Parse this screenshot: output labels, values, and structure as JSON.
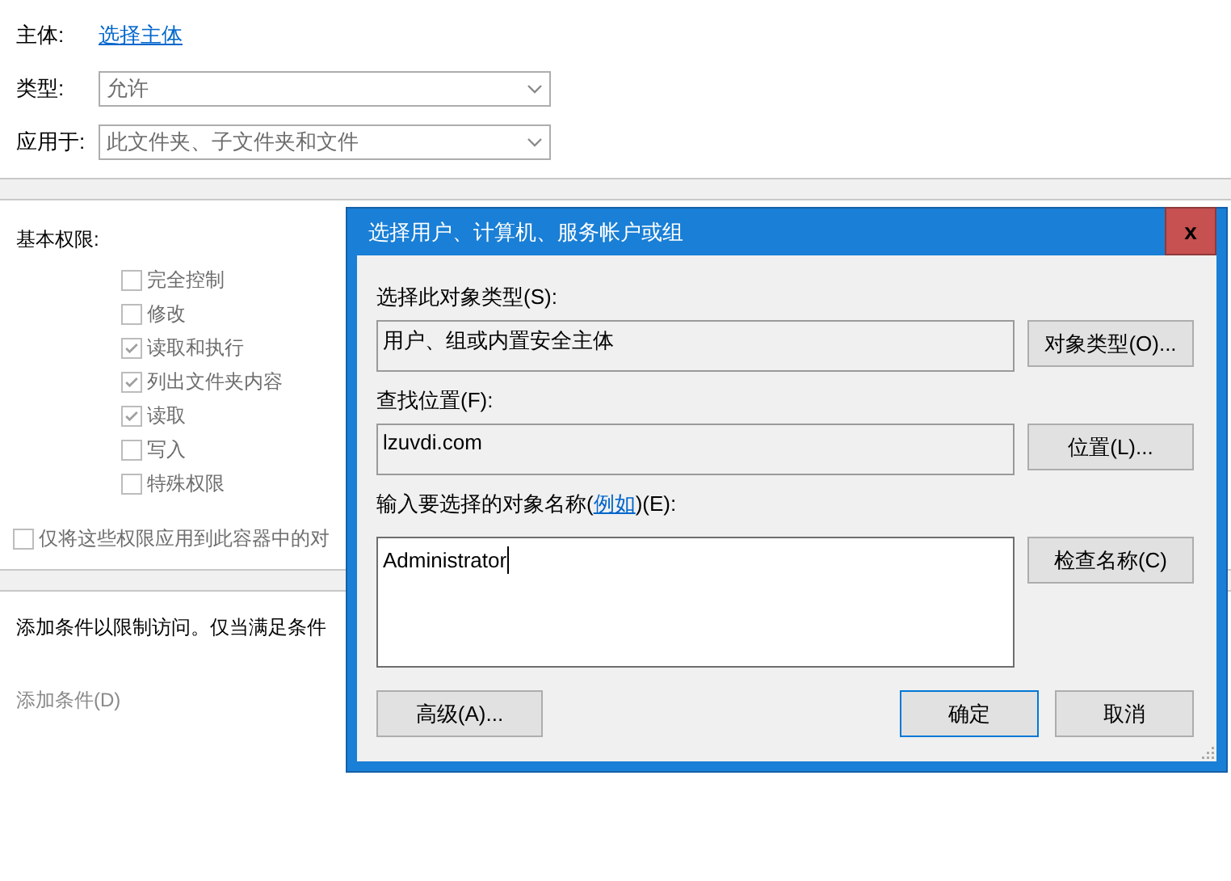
{
  "principal": {
    "label": "主体:",
    "link": "选择主体"
  },
  "fields": [
    {
      "label": "类型:",
      "value": "允许"
    },
    {
      "label": "应用于:",
      "value": "此文件夹、子文件夹和文件"
    }
  ],
  "basic_permissions": {
    "label": "基本权限:",
    "items": [
      {
        "label": "完全控制",
        "checked": false,
        "disabled": true
      },
      {
        "label": "修改",
        "checked": false,
        "disabled": true
      },
      {
        "label": "读取和执行",
        "checked": true,
        "disabled": true
      },
      {
        "label": "列出文件夹内容",
        "checked": true,
        "disabled": true
      },
      {
        "label": "读取",
        "checked": true,
        "disabled": true
      },
      {
        "label": "写入",
        "checked": false,
        "disabled": true
      },
      {
        "label": "特殊权限",
        "checked": false,
        "disabled": true
      }
    ]
  },
  "apply_only": {
    "label": "仅将这些权限应用到此容器中的对",
    "checked": false,
    "disabled": true
  },
  "conditions": {
    "text": "添加条件以限制访问。仅当满足条件",
    "add_link": "添加条件(D)"
  },
  "dialog": {
    "title": "选择用户、计算机、服务帐户或组",
    "close": "x",
    "object_type": {
      "label": "选择此对象类型(S):",
      "value": "用户、组或内置安全主体",
      "button": "对象类型(O)..."
    },
    "location": {
      "label": "查找位置(F):",
      "value": "lzuvdi.com",
      "button": "位置(L)..."
    },
    "names": {
      "label_before": "输入要选择的对象名称(",
      "label_link": "例如",
      "label_after": ")(E):",
      "value": "Administrator",
      "button": "检查名称(C)"
    },
    "buttons": [
      {
        "label": "高级(A)...",
        "default": false
      },
      {
        "label": "确定",
        "default": true
      },
      {
        "label": "取消",
        "default": false
      }
    ]
  }
}
